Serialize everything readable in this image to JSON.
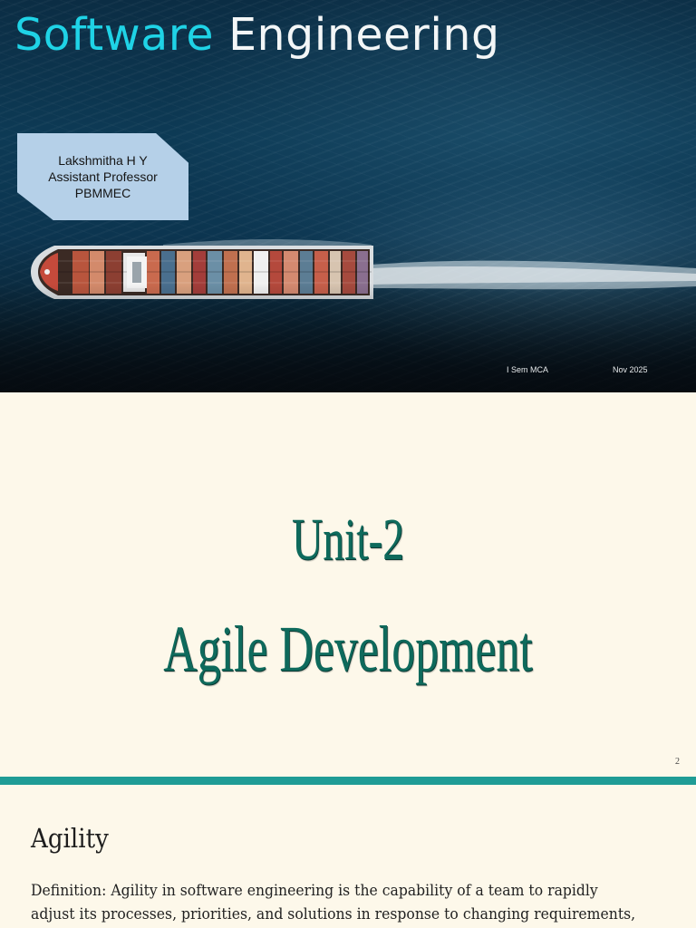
{
  "slide1": {
    "title_part1": "Software",
    "title_part2": "Engineering",
    "author": {
      "name": "Lakshmitha H Y",
      "role": "Assistant Professor",
      "institution": "PBMMEC"
    },
    "footer_left": "I Sem MCA",
    "footer_right": "Nov 2025"
  },
  "slide2": {
    "line1": "Unit-2",
    "line2": "Agile Development",
    "page_number": "2"
  },
  "slide3": {
    "title": "Agility",
    "body_line1": "Definition: Agility in software engineering is the capability of a team to rapidly",
    "body_line2": "adjust its processes, priorities, and solutions in response to changing requirements,"
  },
  "colors": {
    "title_accent": "#1fd3e6",
    "heading_teal": "#0e6a5c",
    "divider_band": "#1f9c96",
    "author_box": "#b5d0e8",
    "slide_background": "#fdf8ea"
  }
}
